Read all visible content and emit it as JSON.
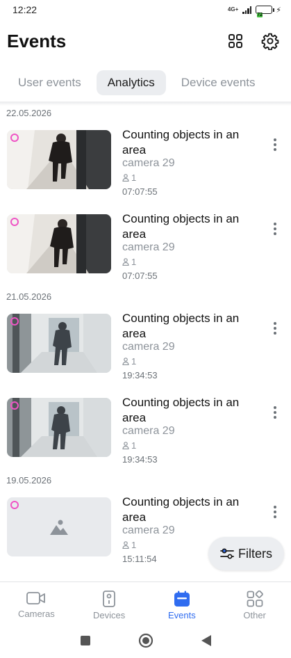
{
  "status": {
    "time": "12:22",
    "network": "4G+",
    "battery": "72"
  },
  "header": {
    "title": "Events"
  },
  "tabs": [
    {
      "label": "User events",
      "active": false
    },
    {
      "label": "Analytics",
      "active": true
    },
    {
      "label": "Device events",
      "active": false
    }
  ],
  "groups": [
    {
      "date": "22.05.2026",
      "events": [
        {
          "title": "Counting objects in an area",
          "camera": "camera 29",
          "count": "1",
          "time": "07:07:55",
          "thumb": "corridor-man-dark"
        },
        {
          "title": "Counting objects in an area",
          "camera": "camera 29",
          "count": "1",
          "time": "07:07:55",
          "thumb": "corridor-man-dark"
        }
      ]
    },
    {
      "date": "21.05.2026",
      "events": [
        {
          "title": "Counting objects in an area",
          "camera": "camera 29",
          "count": "1",
          "time": "19:34:53",
          "thumb": "corridor-man-light"
        },
        {
          "title": "Counting objects in an area",
          "camera": "camera 29",
          "count": "1",
          "time": "19:34:53",
          "thumb": "corridor-man-light"
        }
      ]
    },
    {
      "date": "19.05.2026",
      "events": [
        {
          "title": "Counting objects in an area",
          "camera": "camera 29",
          "count": "1",
          "time": "15:11:54",
          "thumb": "image-placeholder"
        }
      ]
    }
  ],
  "filters": {
    "label": "Filters"
  },
  "bottom_nav": [
    {
      "label": "Cameras",
      "icon": "camera-icon",
      "active": false
    },
    {
      "label": "Devices",
      "icon": "remote-icon",
      "active": false
    },
    {
      "label": "Events",
      "icon": "calendar-icon",
      "active": true
    },
    {
      "label": "Other",
      "icon": "apps-icon",
      "active": false
    }
  ],
  "colors": {
    "accent": "#2f6cf0",
    "marker": "#ef54c5",
    "muted_text": "#8d939a",
    "tab_active_bg": "#ebedf0"
  }
}
